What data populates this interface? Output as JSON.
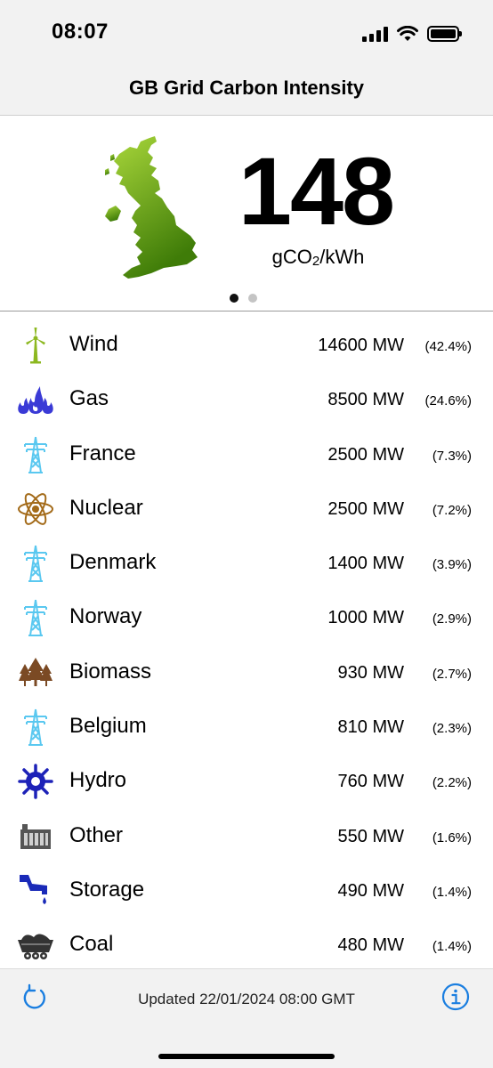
{
  "status_bar": {
    "time": "08:07"
  },
  "nav": {
    "title": "GB Grid Carbon Intensity"
  },
  "hero": {
    "intensity": "148",
    "unit_prefix": "gCO",
    "unit_sub": "2",
    "unit_suffix": "/kWh",
    "page_count": 2,
    "active_page": 1,
    "map_color": "#5a9a10"
  },
  "sources": [
    {
      "icon": "wind-turbine-icon",
      "name": "Wind",
      "mw": "14600 MW",
      "pct": "(42.4%)"
    },
    {
      "icon": "gas-flame-icon",
      "name": "Gas",
      "mw": "8500 MW",
      "pct": "(24.6%)"
    },
    {
      "icon": "pylon-icon",
      "name": "France",
      "mw": "2500 MW",
      "pct": "(7.3%)"
    },
    {
      "icon": "atom-icon",
      "name": "Nuclear",
      "mw": "2500 MW",
      "pct": "(7.2%)"
    },
    {
      "icon": "pylon-icon",
      "name": "Denmark",
      "mw": "1400 MW",
      "pct": "(3.9%)"
    },
    {
      "icon": "pylon-icon",
      "name": "Norway",
      "mw": "1000 MW",
      "pct": "(2.9%)"
    },
    {
      "icon": "trees-icon",
      "name": "Biomass",
      "mw": "930 MW",
      "pct": "(2.7%)"
    },
    {
      "icon": "pylon-icon",
      "name": "Belgium",
      "mw": "810 MW",
      "pct": "(2.3%)"
    },
    {
      "icon": "water-wheel-icon",
      "name": "Hydro",
      "mw": "760 MW",
      "pct": "(2.2%)"
    },
    {
      "icon": "factory-icon",
      "name": "Other",
      "mw": "550 MW",
      "pct": "(1.6%)"
    },
    {
      "icon": "storage-tap-icon",
      "name": "Storage",
      "mw": "490 MW",
      "pct": "(1.4%)"
    },
    {
      "icon": "coal-cart-icon",
      "name": "Coal",
      "mw": "480 MW",
      "pct": "(1.4%)"
    }
  ],
  "toolbar": {
    "updated": "Updated 22/01/2024 08:00 GMT"
  },
  "colors": {
    "wind": "#8cb820",
    "gas": "#3a3ad6",
    "pylon": "#5ac8f0",
    "nuclear": "#a36a18",
    "biomass": "#7b4a24",
    "hydro": "#1d22b8",
    "other": "#555555",
    "storage": "#1a2ab8",
    "coal": "#333333",
    "accent": "#1a7ee0"
  }
}
